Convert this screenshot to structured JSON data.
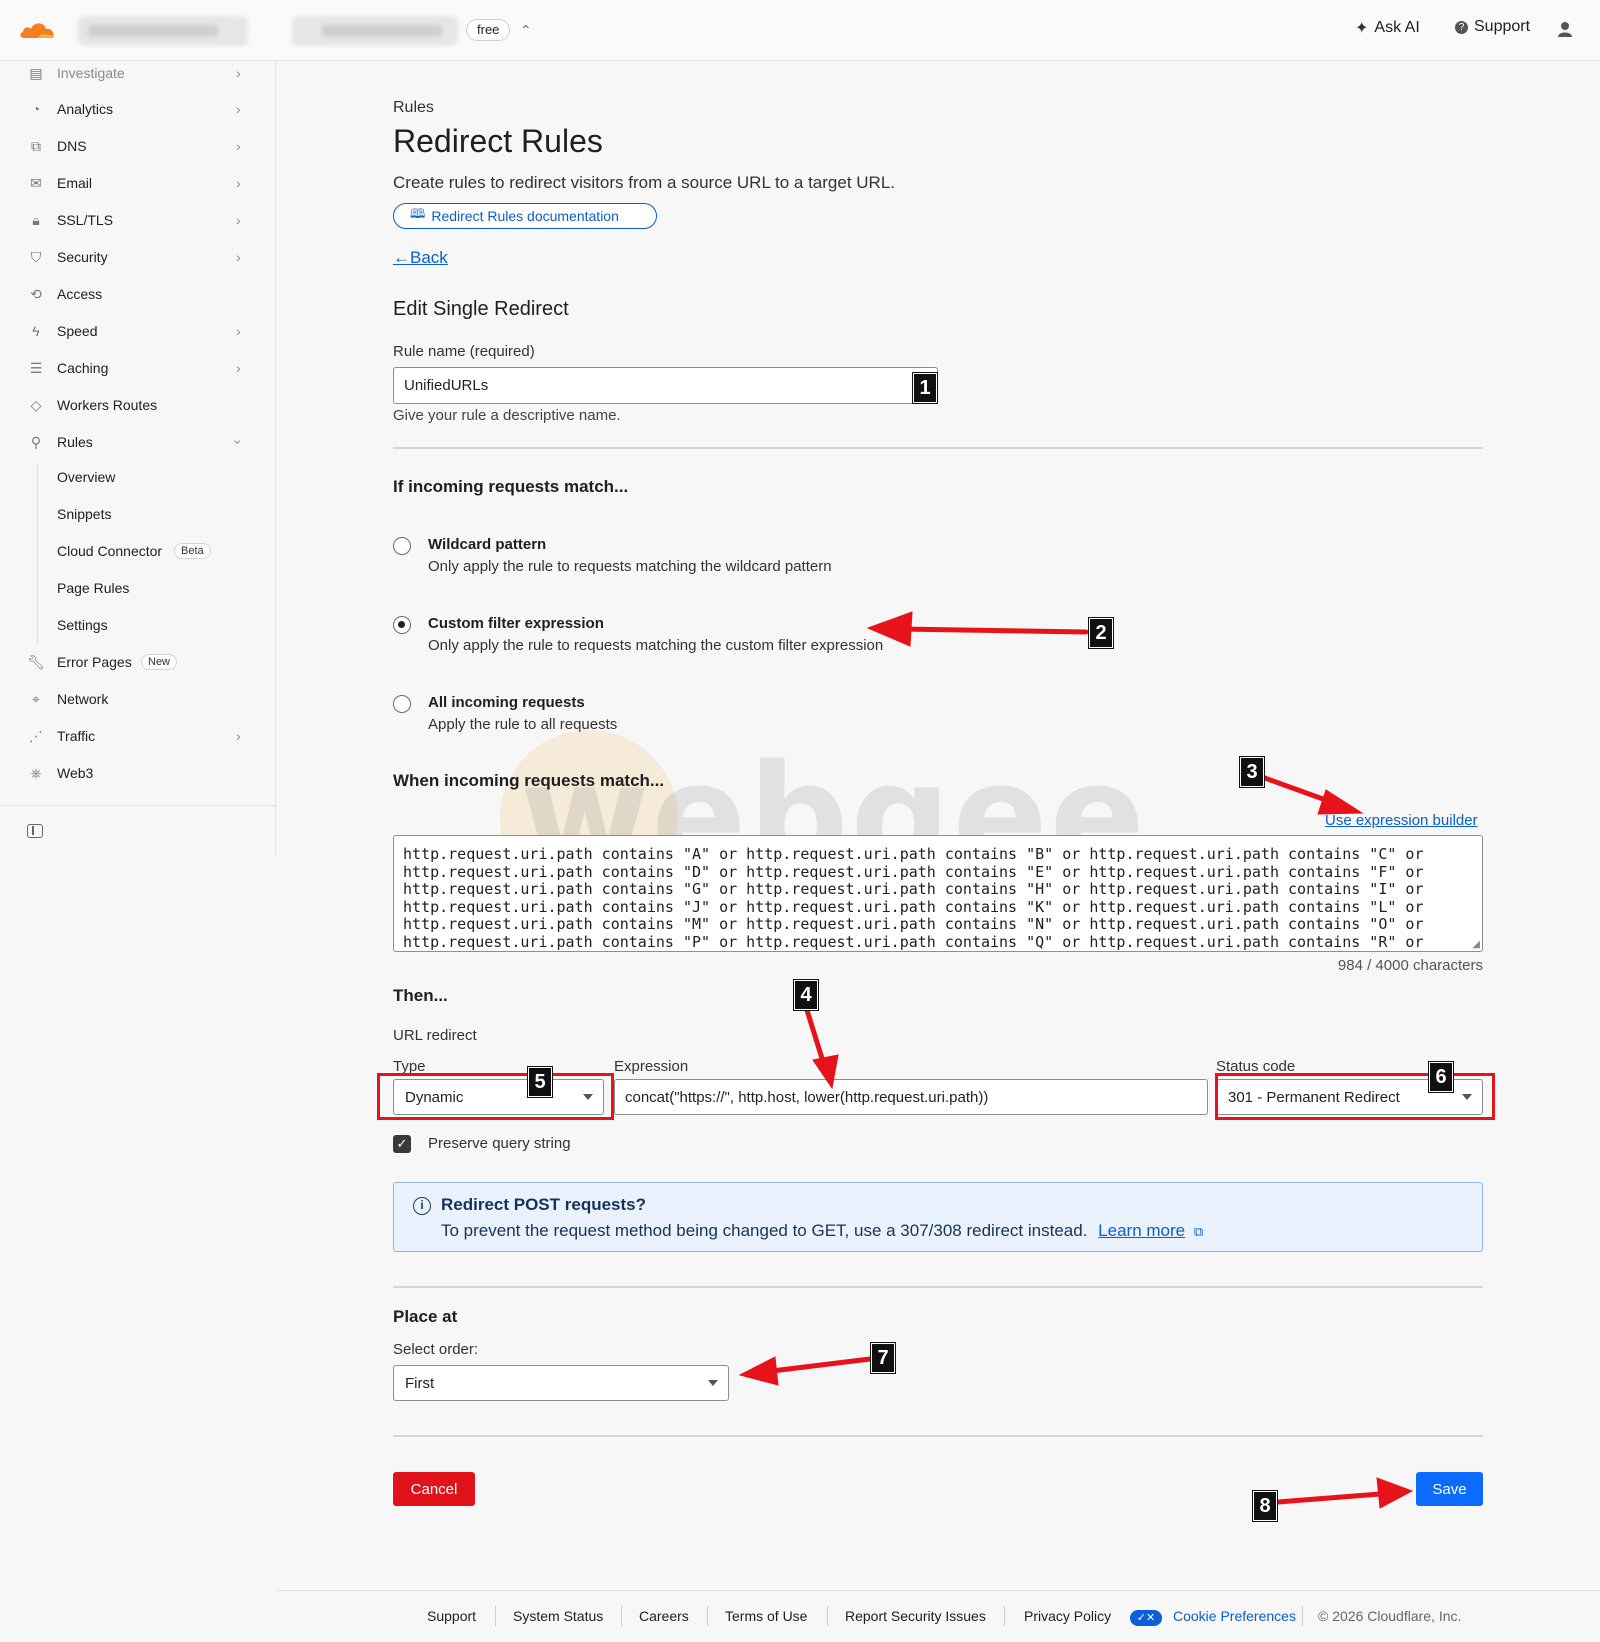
{
  "topbar": {
    "plan": "free",
    "ask_ai": "Ask AI",
    "support": "Support"
  },
  "sidebar": {
    "items": [
      {
        "label": "Investigate",
        "icon": "investigate-icon",
        "chevron": true
      },
      {
        "label": "Analytics",
        "icon": "analytics-icon",
        "chevron": true
      },
      {
        "label": "DNS",
        "icon": "dns-icon",
        "chevron": true
      },
      {
        "label": "Email",
        "icon": "email-icon",
        "chevron": true
      },
      {
        "label": "SSL/TLS",
        "icon": "lock-icon",
        "chevron": true
      },
      {
        "label": "Security",
        "icon": "shield-icon",
        "chevron": true
      },
      {
        "label": "Access",
        "icon": "access-icon",
        "chevron": false
      },
      {
        "label": "Speed",
        "icon": "lightning-icon",
        "chevron": true
      },
      {
        "label": "Caching",
        "icon": "caching-icon",
        "chevron": true
      },
      {
        "label": "Workers Routes",
        "icon": "workers-icon",
        "chevron": false
      },
      {
        "label": "Rules",
        "icon": "rules-icon",
        "chevron": true
      }
    ],
    "rules_sub": [
      {
        "label": "Overview"
      },
      {
        "label": "Snippets"
      },
      {
        "label": "Cloud Connector",
        "badge": "Beta"
      },
      {
        "label": "Page Rules"
      },
      {
        "label": "Settings"
      }
    ],
    "after": [
      {
        "label": "Error Pages",
        "icon": "wrench-icon",
        "badge": "New",
        "chevron": false
      },
      {
        "label": "Network",
        "icon": "location-pin-icon",
        "chevron": false
      },
      {
        "label": "Traffic",
        "icon": "traffic-icon",
        "chevron": true
      },
      {
        "label": "Web3",
        "icon": "web3-icon",
        "chevron": false
      }
    ]
  },
  "page": {
    "breadcrumb": "Rules",
    "title": "Redirect Rules",
    "description": "Create rules to redirect visitors from a source URL to a target URL.",
    "doc_link": "Redirect Rules documentation",
    "back": "Back",
    "edit_heading": "Edit Single Redirect"
  },
  "rule_name": {
    "label": "Rule name (required)",
    "value": "UnifiedURLs",
    "help": "Give your rule a descriptive name."
  },
  "match": {
    "heading": "If incoming requests match...",
    "options": [
      {
        "title": "Wildcard pattern",
        "desc": "Only apply the rule to requests matching the wildcard pattern",
        "selected": false
      },
      {
        "title": "Custom filter expression",
        "desc": "Only apply the rule to requests matching the custom filter expression",
        "selected": true
      },
      {
        "title": "All incoming requests",
        "desc": "Apply the rule to all requests",
        "selected": false
      }
    ]
  },
  "expression": {
    "heading": "When incoming requests match...",
    "builder_link": "Use expression builder",
    "lines": [
      "http.request.uri.path contains \"A\" or http.request.uri.path contains \"B\" or http.request.uri.path contains \"C\" or",
      "http.request.uri.path contains \"D\" or http.request.uri.path contains \"E\" or http.request.uri.path contains \"F\" or",
      "http.request.uri.path contains \"G\" or http.request.uri.path contains \"H\" or http.request.uri.path contains \"I\" or",
      "http.request.uri.path contains \"J\" or http.request.uri.path contains \"K\" or http.request.uri.path contains \"L\" or",
      "http.request.uri.path contains \"M\" or http.request.uri.path contains \"N\" or http.request.uri.path contains \"O\" or",
      "http.request.uri.path contains \"P\" or http.request.uri.path contains \"Q\" or http.request.uri.path contains \"R\" or"
    ],
    "char_count": "984 / 4000 characters"
  },
  "then": {
    "heading": "Then...",
    "url_redirect": "URL redirect",
    "type_label": "Type",
    "type_value": "Dynamic",
    "expr_label": "Expression",
    "expr_value": "concat(\"https://\", http.host, lower(http.request.uri.path))",
    "status_label": "Status code",
    "status_value": "301 - Permanent Redirect",
    "preserve_query": "Preserve query string",
    "preserve_checked": true
  },
  "info": {
    "title": "Redirect POST requests?",
    "body": "To prevent the request method being changed to GET, use a 307/308 redirect instead.",
    "link": "Learn more"
  },
  "place": {
    "heading": "Place at",
    "label": "Select order:",
    "value": "First"
  },
  "actions": {
    "cancel": "Cancel",
    "save": "Save"
  },
  "annotations": [
    "1",
    "2",
    "3",
    "4",
    "5",
    "6",
    "7",
    "8"
  ],
  "watermark": "webgee",
  "footer": {
    "items": [
      "Support",
      "System Status",
      "Careers",
      "Terms of Use",
      "Report Security Issues",
      "Privacy Policy",
      "Cookie Preferences"
    ],
    "copyright": "© 2026 Cloudflare, Inc."
  },
  "colors": {
    "accent": "#0b6bff",
    "link": "#0a5ed7",
    "danger": "#e0131b",
    "annotation_red": "#e8121b",
    "cloudflare_orange": "#f38020"
  }
}
